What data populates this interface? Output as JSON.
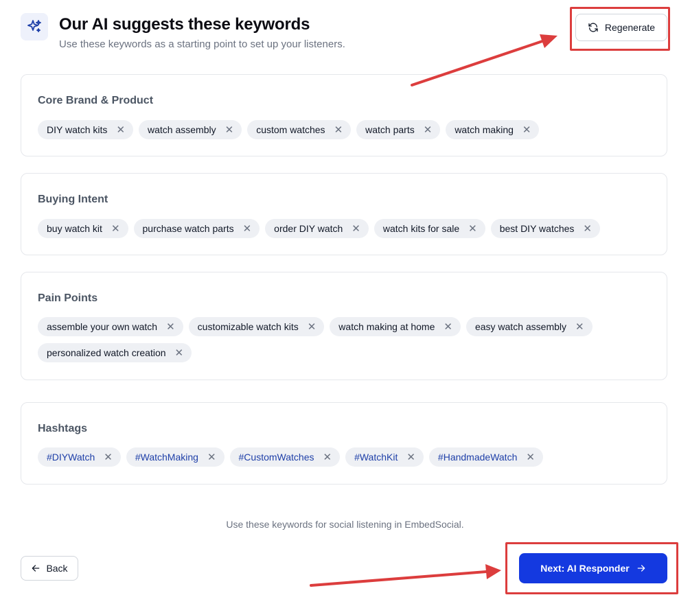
{
  "header": {
    "icon": "sparkles-icon",
    "title": "Our AI suggests these keywords",
    "subtitle": "Use these keywords as a starting point to set up your listeners.",
    "regenerate_label": "Regenerate",
    "regenerate_icon": "refresh-icon"
  },
  "sections": [
    {
      "title": "Core Brand & Product",
      "keywords": [
        "DIY watch kits",
        "watch assembly",
        "custom watches",
        "watch parts",
        "watch making"
      ]
    },
    {
      "title": "Buying Intent",
      "keywords": [
        "buy watch kit",
        "purchase watch parts",
        "order DIY watch",
        "watch kits for sale",
        "best DIY watches"
      ]
    },
    {
      "title": "Pain Points",
      "keywords": [
        "assemble your own watch",
        "customizable watch kits",
        "watch making at home",
        "easy watch assembly",
        "personalized watch creation"
      ]
    },
    {
      "title": "Hashtags",
      "keywords": [
        "#DIYWatch",
        "#WatchMaking",
        "#CustomWatches",
        "#WatchKit",
        "#HandmadeWatch"
      ]
    }
  ],
  "remove_glyph": "✕",
  "footer": {
    "note": "Use these keywords for social listening in EmbedSocial.",
    "back_label": "Back",
    "next_label": "Next: AI Responder"
  },
  "colors": {
    "primary": "#1439e0",
    "hashtag_text": "#1e3fa8",
    "chip_bg": "#eef0f4",
    "annotation_red": "#dc3d3d"
  }
}
